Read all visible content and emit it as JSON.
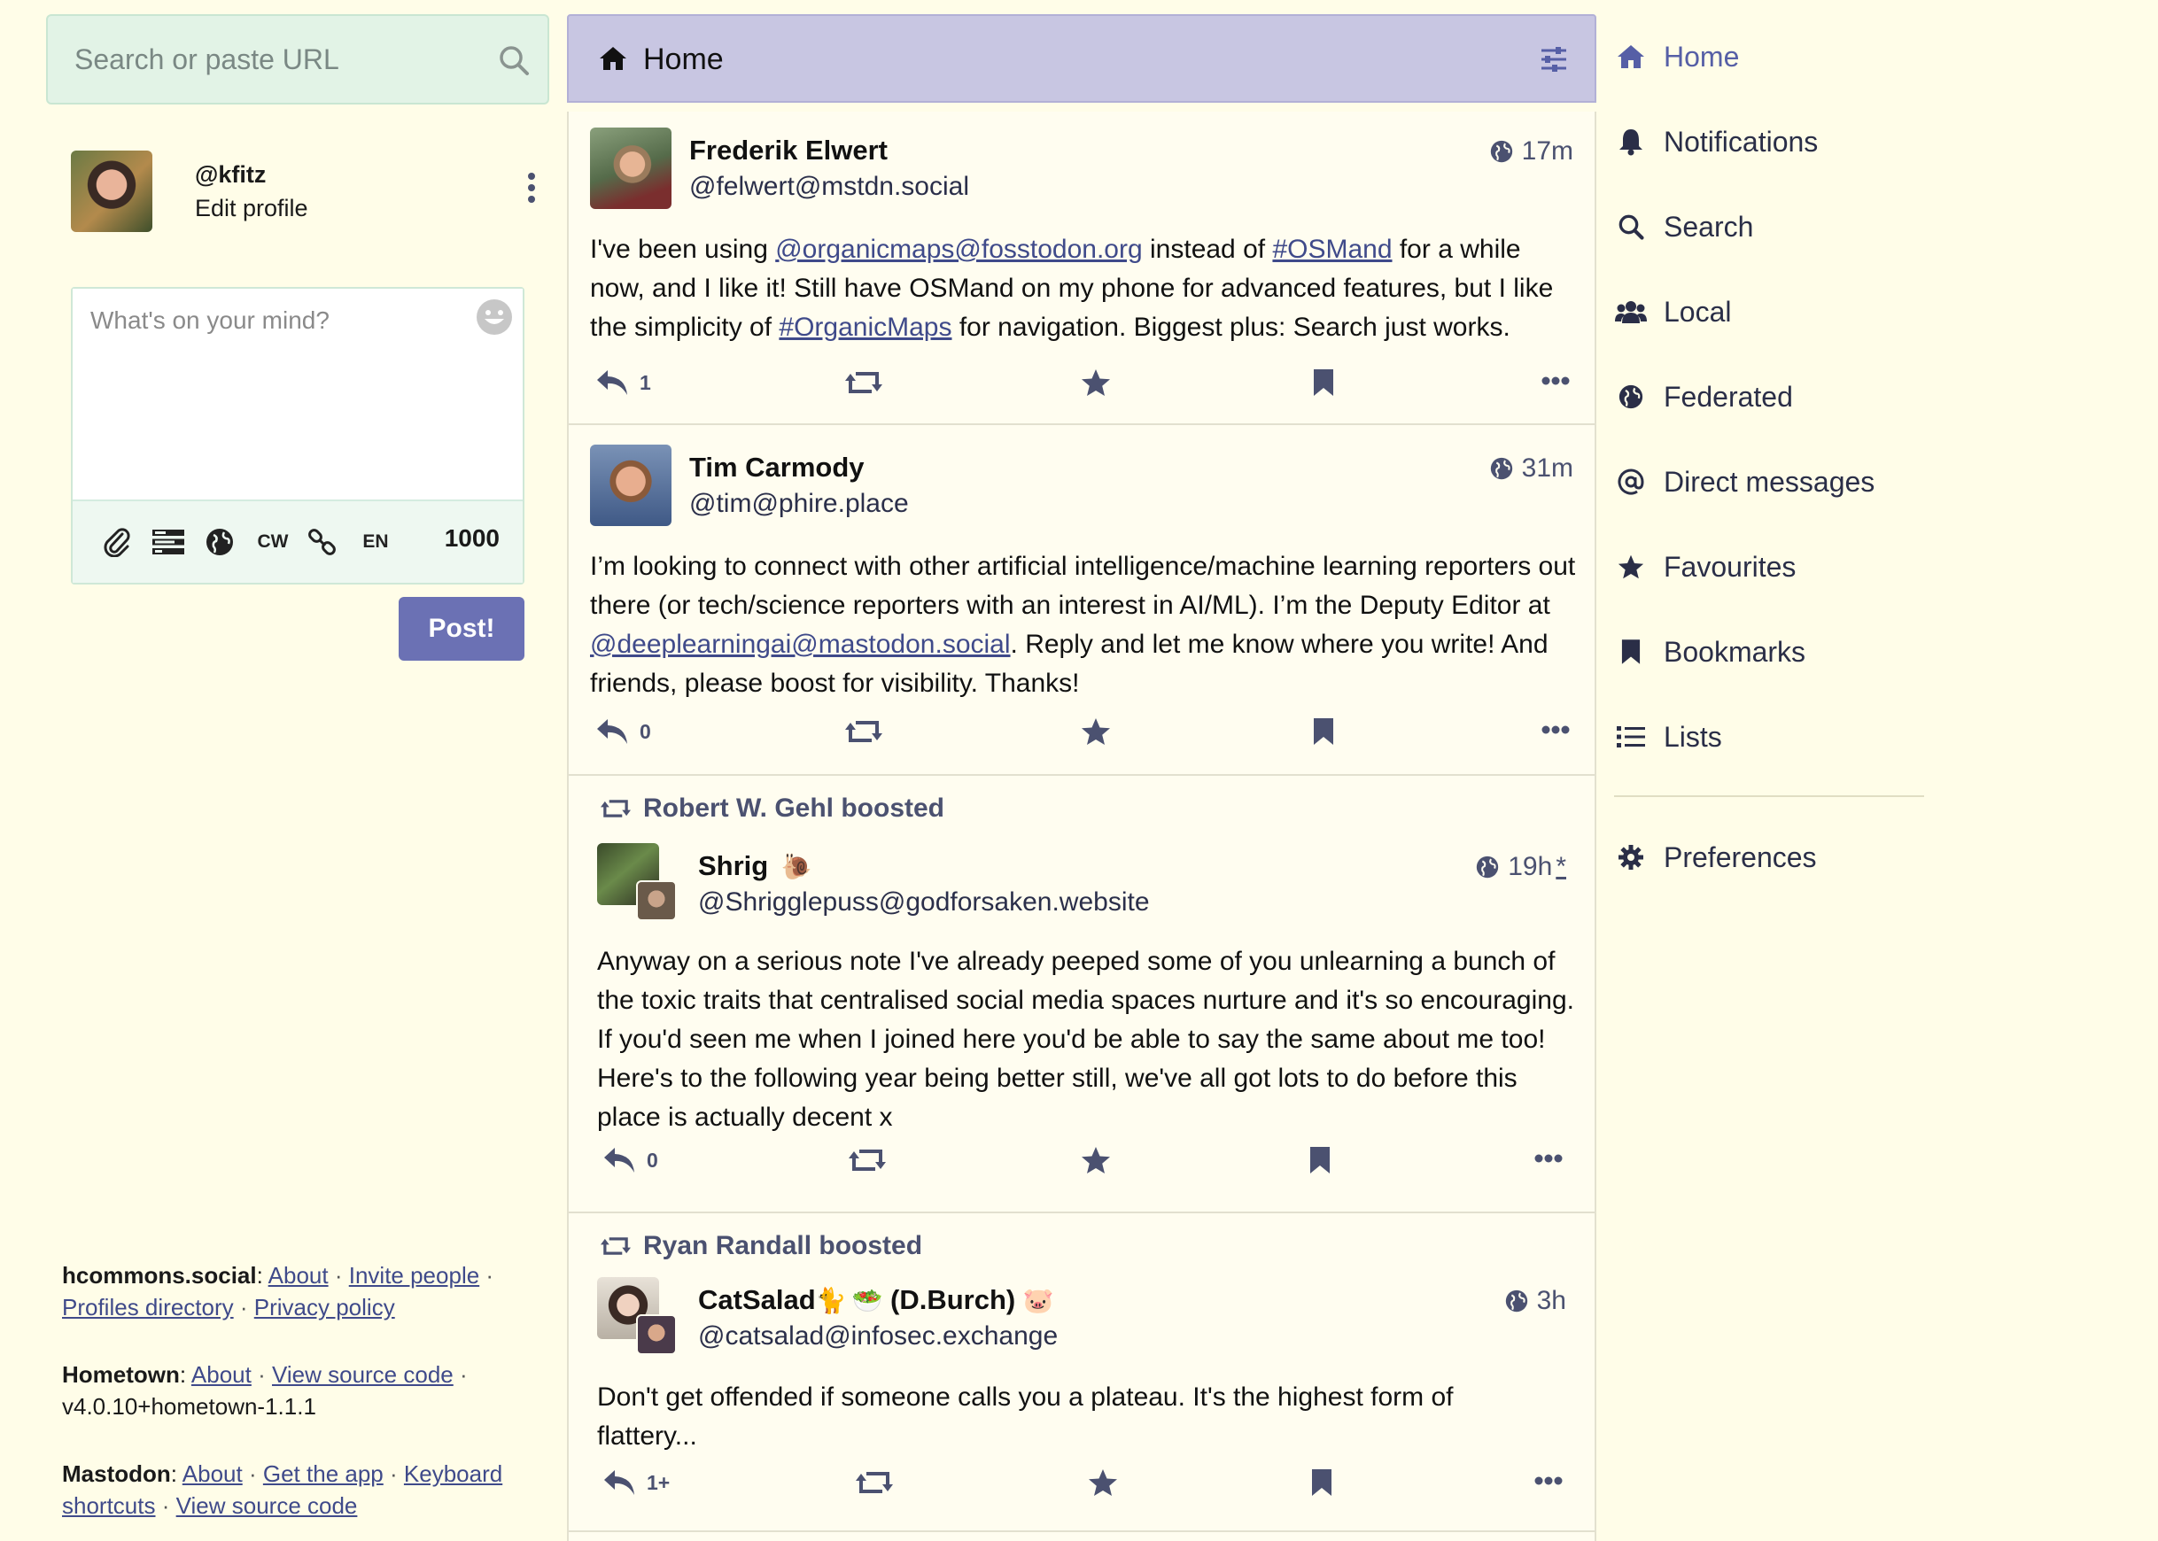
{
  "search": {
    "placeholder": "Search or paste URL"
  },
  "account": {
    "handle": "@kfitz",
    "edit_label": "Edit profile"
  },
  "compose": {
    "placeholder": "What's on your mind?",
    "cw_label": "CW",
    "lang_label": "EN",
    "char_count": "1000",
    "post_label": "Post!"
  },
  "footer": {
    "instance": {
      "name": "hcommons.social",
      "about": "About",
      "invite": "Invite people",
      "profiles": "Profiles directory",
      "privacy": "Privacy policy"
    },
    "hometown": {
      "name": "Hometown",
      "about": "About",
      "source": "View source code",
      "version": "v4.0.10+hometown-1.1.1"
    },
    "mastodon": {
      "name": "Mastodon",
      "about": "About",
      "get_app": "Get the app",
      "shortcuts_a": "Keyboard",
      "shortcuts_b": "shortcuts",
      "source": "View source code"
    }
  },
  "column": {
    "title": "Home"
  },
  "statuses": [
    {
      "name": "Frederik Elwert",
      "handle": "@felwert@mstdn.social",
      "time": "17m",
      "content": {
        "t1": "I've been using ",
        "m1": "@organicmaps@fosstodon.org",
        "t2": "  instead of ",
        "h1": "#OSMand",
        "t3": " for a while now, and I like it! Still have OSMand on my phone for advanced features, but I like the simplicity of ",
        "h2": "#OrganicMaps",
        "t4": " for navigation. Biggest plus: Search just works."
      },
      "replies": "1"
    },
    {
      "name": "Tim Carmody",
      "handle": "@tim@phire.place",
      "time": "31m",
      "content": {
        "t1": "I’m looking to connect with other artificial intelligence/machine learning reporters out there (or tech/science reporters with an interest in AI/ML). I’m the Deputy Editor at ",
        "m1": "@deeplearningai@mastodon.social",
        "t2": ". Reply and let me know where you write! And friends, please boost for visibility. Thanks!"
      },
      "replies": "0"
    },
    {
      "boosted_by": "Robert W. Gehl boosted",
      "name": "Shrig",
      "name_emoji": "🐌",
      "handle": "@Shrigglepuss@godforsaken.website",
      "time": "19h",
      "edited_mark": "*",
      "content": {
        "t1": "Anyway on a serious note I've already peeped some of you unlearning a bunch of the toxic traits that centralised social media spaces nurture and it's so encouraging. If you'd seen me when I joined here you'd be able to say the same about me too! Here's to the following year being better still, we've all got lots to do before this place is actually decent x"
      },
      "replies": "0"
    },
    {
      "boosted_by": "Ryan Randall boosted",
      "name": "CatSalad",
      "name_emoji_1": "🐈",
      "name_emoji_2": "🥗",
      "name_mid": " (D.Burch) ",
      "name_emoji_3": "🐷",
      "handle": "@catsalad@infosec.exchange",
      "time": "3h",
      "content": {
        "t1": "Don't get offended if someone calls you a plateau. It's the highest form of flattery..."
      },
      "replies": "1+"
    }
  ],
  "nav": [
    {
      "label": "Home",
      "icon": "home-icon"
    },
    {
      "label": "Notifications",
      "icon": "bell-icon"
    },
    {
      "label": "Search",
      "icon": "search-icon"
    },
    {
      "label": "Local",
      "icon": "users-icon"
    },
    {
      "label": "Federated",
      "icon": "globe-icon"
    },
    {
      "label": "Direct messages",
      "icon": "at-icon"
    },
    {
      "label": "Favourites",
      "icon": "star-icon"
    },
    {
      "label": "Bookmarks",
      "icon": "bookmark-icon"
    },
    {
      "label": "Lists",
      "icon": "list-icon"
    },
    {
      "label": "Preferences",
      "icon": "gear-icon"
    }
  ],
  "colors": {
    "background": "#fffde8",
    "header": "#c8c6e2",
    "accent": "#6b71b4",
    "search_bg": "#e2f3e6",
    "icon": "#4b5170"
  }
}
